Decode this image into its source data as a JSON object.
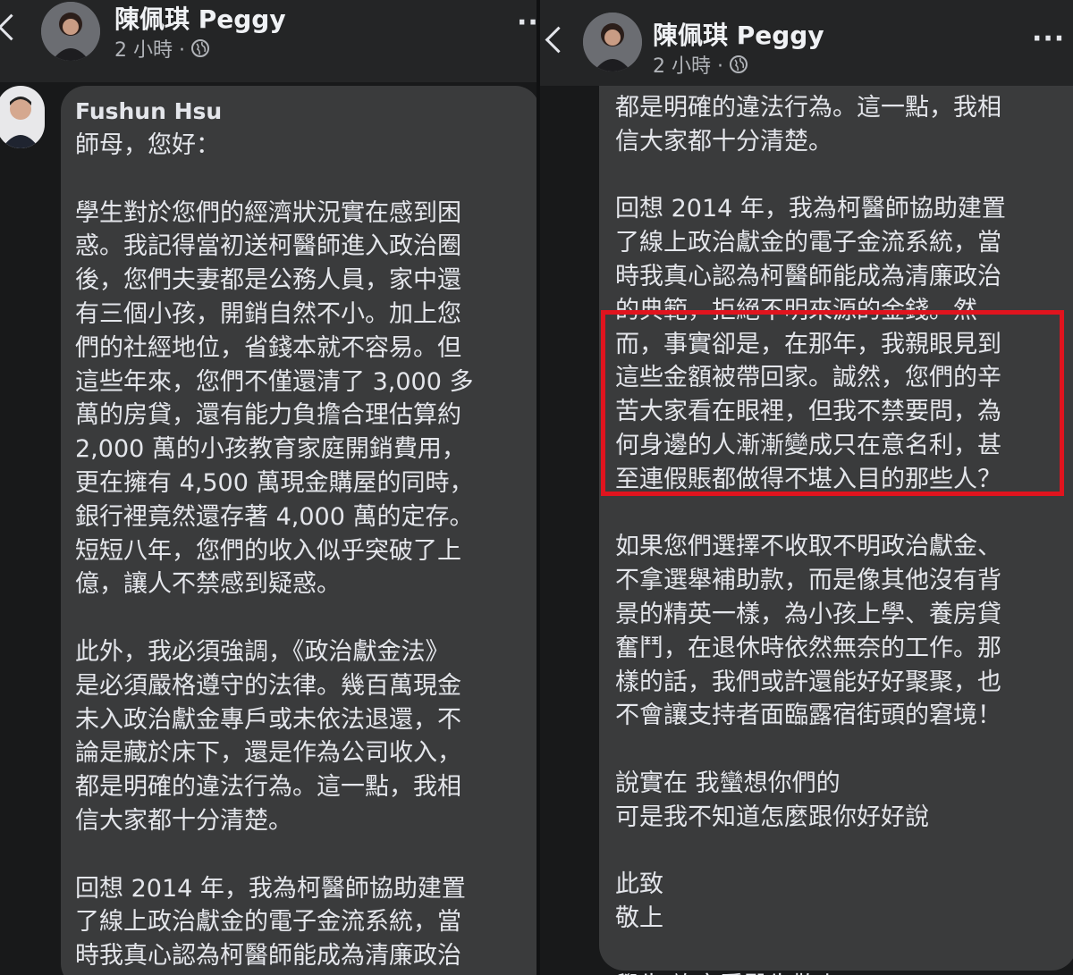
{
  "left": {
    "header": {
      "poster_name": "陳佩琪 Peggy",
      "timestamp": "2 小時 ·",
      "more": "···"
    },
    "comment": {
      "author": "Fushun Hsu",
      "lines": [
        "師母，您好：",
        "",
        "學生對於您們的經濟狀況實在感到困",
        "惑。我記得當初送柯醫師進入政治圈",
        "後，您們夫妻都是公務人員，家中還",
        "有三個小孩，開銷自然不小。加上您",
        "們的社經地位，省錢本就不容易。但",
        "這些年來，您們不僅還清了 3,000 多",
        "萬的房貸，還有能力負擔合理估算約",
        "2,000 萬的小孩教育家庭開銷費用，",
        "更在擁有 4,500 萬現金購屋的同時，",
        "銀行裡竟然還存著 4,000 萬的定存。",
        "短短八年，您們的收入似乎突破了上",
        "億，讓人不禁感到疑惑。",
        "",
        "此外，我必須強調，《政治獻金法》",
        "是必須嚴格遵守的法律。幾百萬現金",
        "未入政治獻金專戶或未依法退還，不",
        "論是藏於床下，還是作為公司收入，",
        "都是明確的違法行為。這一點，我相",
        "信大家都十分清楚。",
        "",
        "回想 2014 年，我為柯醫師協助建置",
        "了線上政治獻金的電子金流系統，當",
        "時我真心認為柯醫師能成為清廉政治"
      ]
    }
  },
  "right": {
    "header": {
      "poster_name": "陳佩琪 Peggy",
      "timestamp": "2 小時 ·",
      "more": "···"
    },
    "comment": {
      "lines": [
        "都是明確的違法行為。這一點，我相",
        "信大家都十分清楚。",
        "",
        "回想 2014 年，我為柯醫師協助建置",
        "了線上政治獻金的電子金流系統，當",
        "時我真心認為柯醫師能成為清廉政治",
        "的典範，拒絕不明來源的金錢。然",
        "而，事實卻是，在那年，我親眼見到",
        "這些金額被帶回家。誠然，您們的辛",
        "苦大家看在眼裡，但我不禁要問，為",
        "何身邊的人漸漸變成只在意名利，甚",
        "至連假賬都做得不堪入目的那些人？",
        "",
        "如果您們選擇不收取不明政治獻金、",
        "不拿選舉補助款，而是像其他沒有背",
        "景的精英一樣，為小孩上學、養房貸",
        "奮鬥，在退休時依然無奈的工作。那",
        "樣的話，我們或許還能好好聚聚，也",
        "不會讓支持者面臨露宿街頭的窘境！",
        "",
        "說實在 我蠻想你們的",
        "可是我不知道怎麼跟你好好說",
        "",
        "此致",
        "敬上",
        "",
        "學生 許富舜醫生敬上"
      ]
    }
  },
  "colors": {
    "background": "#18191a",
    "header": "#242526",
    "bubble": "#3a3b3c",
    "text": "#e4e6eb",
    "meta": "#b0b3b8",
    "highlight": "#e0141e"
  },
  "icons": {
    "back": "chevron-left-icon",
    "privacy": "globe-icon",
    "more": "more-horizontal-icon"
  }
}
